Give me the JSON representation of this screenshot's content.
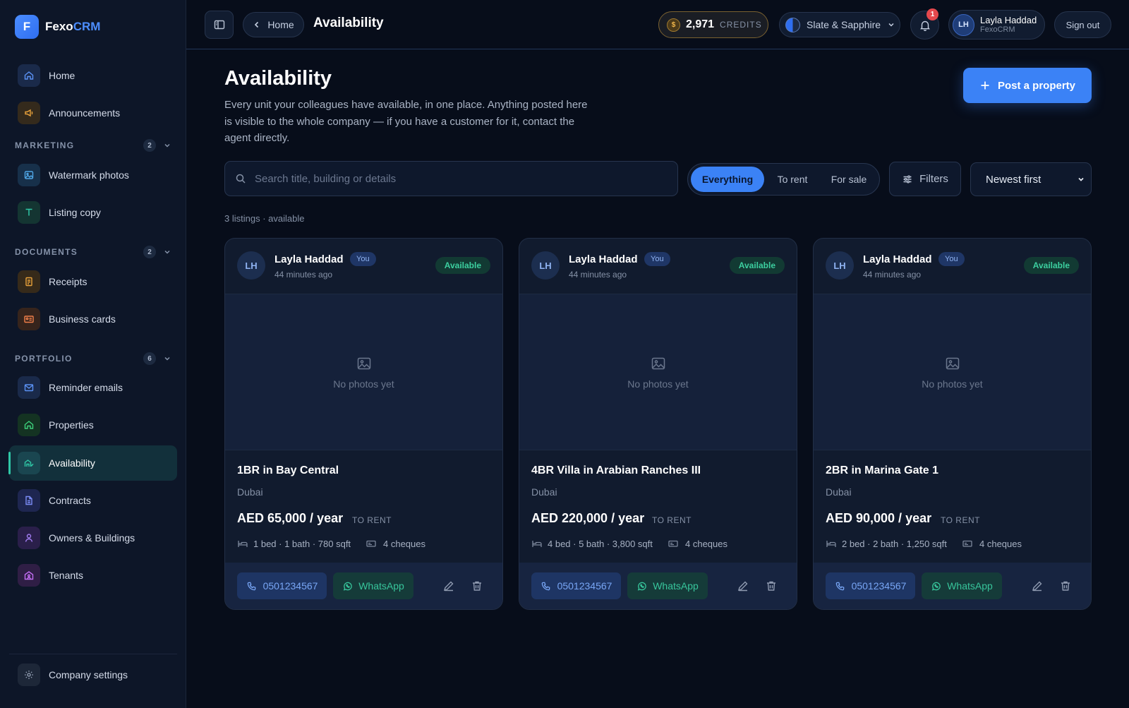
{
  "app": {
    "logo_letter": "F",
    "name_part1": "Fexo",
    "name_part2": "CRM"
  },
  "sidebar": {
    "top_items": [
      {
        "label": "Home",
        "icon": "home-icon"
      },
      {
        "label": "Announcements",
        "icon": "megaphone-icon"
      }
    ],
    "sections": [
      {
        "title": "MARKETING",
        "count": "2",
        "items": [
          {
            "label": "Watermark photos",
            "icon": "image-icon"
          },
          {
            "label": "Listing copy",
            "icon": "text-icon"
          }
        ]
      },
      {
        "title": "DOCUMENTS",
        "count": "2",
        "items": [
          {
            "label": "Receipts",
            "icon": "receipt-icon"
          },
          {
            "label": "Business cards",
            "icon": "id-card-icon"
          }
        ]
      },
      {
        "title": "PORTFOLIO",
        "count": "6",
        "items": [
          {
            "label": "Reminder emails",
            "icon": "mail-icon"
          },
          {
            "label": "Properties",
            "icon": "house-icon"
          },
          {
            "label": "Availability",
            "icon": "availability-icon",
            "active": true
          },
          {
            "label": "Contracts",
            "icon": "file-icon"
          },
          {
            "label": "Owners & Buildings",
            "icon": "person-icon"
          },
          {
            "label": "Tenants",
            "icon": "tenants-icon"
          }
        ]
      }
    ],
    "footer_item": {
      "label": "Company settings",
      "icon": "gear-icon"
    }
  },
  "topbar": {
    "back_label": "Home",
    "title": "Availability",
    "credits_value": "2,971",
    "credits_label": "CREDITS",
    "coin_symbol": "$",
    "theme_label": "Slate & Sapphire",
    "notifications_count": "1",
    "user_initials": "LH",
    "user_name": "Layla Haddad",
    "user_org": "FexoCRM",
    "sign_out_label": "Sign out"
  },
  "main": {
    "title": "Availability",
    "description": "Every unit your colleagues have available, in one place. Anything posted here is visible to the whole company — if you have a customer for it, contact the agent directly.",
    "post_button": "Post a property",
    "search_placeholder": "Search title, building or details",
    "search_value": "",
    "segments": [
      "Everything",
      "To rent",
      "For sale"
    ],
    "active_segment": "Everything",
    "filters_label": "Filters",
    "sort_value": "Newest first",
    "result_summary": "3 listings · available"
  },
  "listings": [
    {
      "agent_initials": "LH",
      "agent": "Layla Haddad",
      "you_label": "You",
      "posted": "44 minutes ago",
      "status": "Available",
      "photo_placeholder": "No photos yet",
      "title": "1BR in Bay Central",
      "city": "Dubai",
      "price": "AED 65,000 / year",
      "deal_type": "TO RENT",
      "details": "1 bed · 1 bath · 780 sqft",
      "cheques": "4 cheques",
      "phone": "0501234567",
      "whatsapp_label": "WhatsApp"
    },
    {
      "agent_initials": "LH",
      "agent": "Layla Haddad",
      "you_label": "You",
      "posted": "44 minutes ago",
      "status": "Available",
      "photo_placeholder": "No photos yet",
      "title": "4BR Villa in Arabian Ranches III",
      "city": "Dubai",
      "price": "AED 220,000 / year",
      "deal_type": "TO RENT",
      "details": "4 bed · 5 bath · 3,800 sqft",
      "cheques": "4 cheques",
      "phone": "0501234567",
      "whatsapp_label": "WhatsApp"
    },
    {
      "agent_initials": "LH",
      "agent": "Layla Haddad",
      "you_label": "You",
      "posted": "44 minutes ago",
      "status": "Available",
      "photo_placeholder": "No photos yet",
      "title": "2BR in Marina Gate 1",
      "city": "Dubai",
      "price": "AED 90,000 / year",
      "deal_type": "TO RENT",
      "details": "2 bed · 2 bath · 1,250 sqft",
      "cheques": "4 cheques",
      "phone": "0501234567",
      "whatsapp_label": "WhatsApp"
    }
  ],
  "colors": {
    "accent": "#3b82f6",
    "success": "#3ccf9f",
    "background": "#070d1a",
    "sidebar": "#0d1628"
  }
}
